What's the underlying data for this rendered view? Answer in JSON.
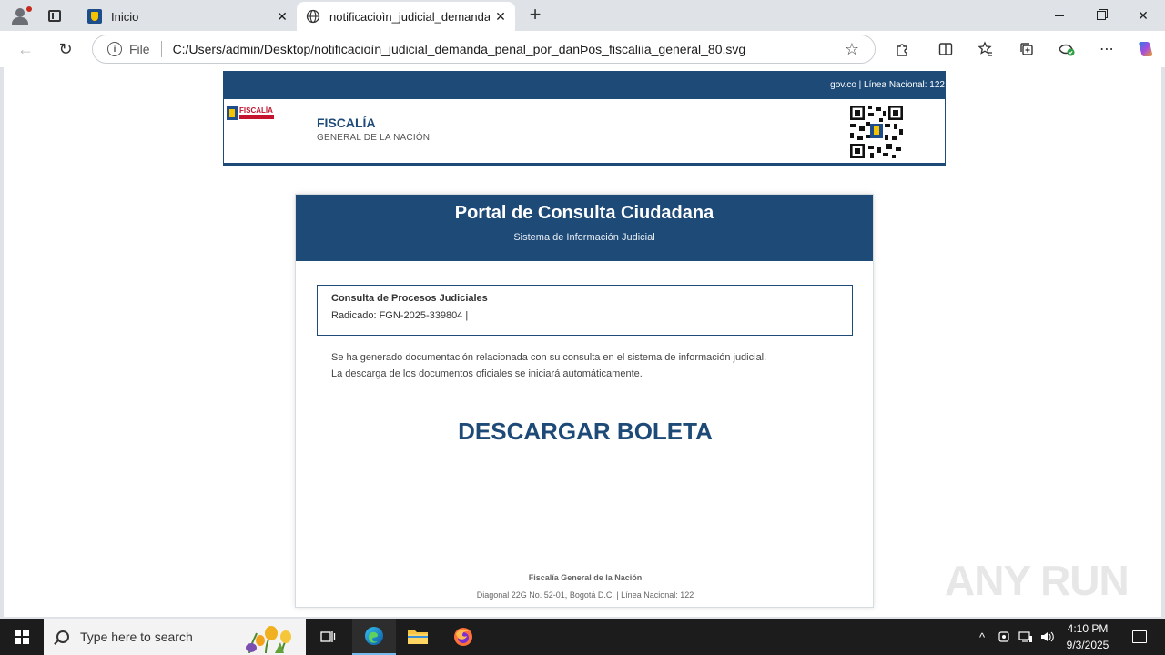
{
  "browser": {
    "tabs": [
      {
        "title": "Inicio",
        "active": false
      },
      {
        "title": "notificacioìn_judicial_demanda_pe",
        "active": true
      }
    ],
    "address": {
      "scheme_label": "File",
      "url": "C:/Users/admin/Desktop/notificacioìn_judicial_demanda_penal_por_danÞos_fiscaliìa_general_80.svg"
    }
  },
  "page": {
    "topband_text": "gov.co | Línea Nacional: 122",
    "logo_text": "FISCALÍA",
    "org_title": "FISCALÍA",
    "org_subtitle": "GENERAL DE LA NACIÓN",
    "portal_title": "Portal de Consulta Ciudadana",
    "portal_subtitle": "Sistema de Información Judicial",
    "consulta_title": "Consulta de Procesos Judiciales",
    "radicado": "Radicado: FGN-2025-339804 |",
    "message_line1": "Se ha generado documentación relacionada con su consulta en el sistema de información judicial.",
    "message_line2": "La descarga de los documentos oficiales se iniciará automáticamente.",
    "download_label": "DESCARGAR BOLETA",
    "footer_org": "Fiscalía General de la Nación",
    "footer_address": "Diagonal 22G No. 52-01, Bogotá D.C. | Línea Nacional: 122"
  },
  "watermark": "ANY RUN",
  "taskbar": {
    "search_placeholder": "Type here to search",
    "time": "4:10 PM",
    "date": "9/3/2025"
  },
  "colors": {
    "brand_blue": "#1e4a78",
    "brand_red": "#c4122f",
    "taskbar": "#1c1c1c"
  }
}
